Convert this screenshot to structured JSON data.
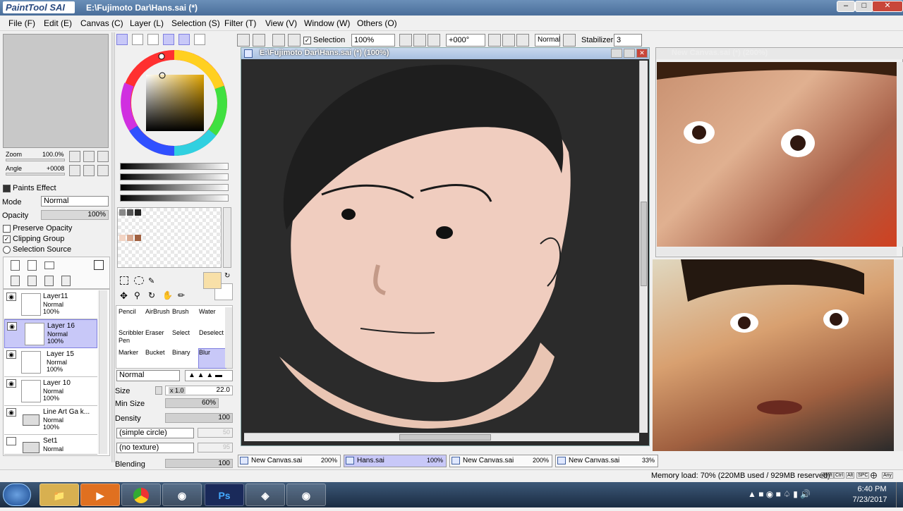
{
  "titlebar": {
    "logo": "PaintTool SAI",
    "title": "E:\\Fujimoto Dar\\Hans.sai (*)"
  },
  "menu": [
    "File (F)",
    "Edit (E)",
    "Canvas (C)",
    "Layer (L)",
    "Selection (S)",
    "Filter (T)",
    "View (V)",
    "Window (W)",
    "Others (O)"
  ],
  "toolbar": {
    "selection_label": "Selection",
    "zoom": "100%",
    "rotation": "+000°",
    "mode": "Normal",
    "stabilizer_label": "Stabilizer",
    "stabilizer_value": "3"
  },
  "navigator": {
    "zoom_label": "Zoom",
    "zoom_value": "100.0%",
    "angle_label": "Angle",
    "angle_value": "+0008"
  },
  "paints": {
    "section": "Paints Effect",
    "mode_label": "Mode",
    "mode_value": "Normal",
    "opacity_label": "Opacity",
    "opacity_value": "100%",
    "preserve_opacity": "Preserve Opacity",
    "clipping_group": "Clipping Group",
    "selection_source": "Selection Source"
  },
  "layers": [
    {
      "name": "Layer11",
      "mode": "Normal",
      "opacity": "100%"
    },
    {
      "name": "Layer 16",
      "mode": "Normal",
      "opacity": "100%"
    },
    {
      "name": "Layer 15",
      "mode": "Normal",
      "opacity": "100%"
    },
    {
      "name": "Layer 10",
      "mode": "Normal",
      "opacity": "100%"
    },
    {
      "name": "Line Art Ga k...",
      "mode": "Normal",
      "opacity": "100%"
    },
    {
      "name": "Set1",
      "mode": "Normal",
      "opacity": ""
    }
  ],
  "tools": [
    [
      "Pencil",
      "AirBrush",
      "Brush",
      "Water"
    ],
    [
      "Scribbler Pen",
      "Eraser",
      "Select",
      "Deselect"
    ],
    [
      "Marker",
      "Bucket",
      "Binary",
      "Blur"
    ]
  ],
  "brush": {
    "mode": "Normal",
    "size_label": "Size",
    "size_mult": "x 1.0",
    "size_value": "22.0",
    "minsize_label": "Min Size",
    "minsize_value": "60%",
    "density_label": "Density",
    "density_value": "100",
    "shape": "(simple circle)",
    "shape_value": "50",
    "texture": "(no texture)",
    "texture_value": "95",
    "blending_label": "Blending",
    "blending_value": "100"
  },
  "canvas_title": "E:\\Fujimoto Dar\\Hans.sai (*) (100%)",
  "photo_title": "New Canvas.sai (*) (200%)",
  "tabs": [
    {
      "name": "New Canvas.sai",
      "pct": "200%"
    },
    {
      "name": "Hans.sai",
      "pct": "100%"
    },
    {
      "name": "New Canvas.sai",
      "pct": "200%"
    },
    {
      "name": "New Canvas.sai",
      "pct": "33%"
    }
  ],
  "memory": "Memory load: 70% (220MB used / 929MB reserved)",
  "status_keys": [
    "Shift",
    "Ctrl",
    "Alt",
    "SPC",
    "Any"
  ],
  "clock": {
    "time": "6:40 PM",
    "date": "7/23/2017"
  },
  "taskbar_apps": [
    "start",
    "explorer",
    "media-player",
    "chrome",
    "network-app",
    "photoshop",
    "game-app",
    "recorder-app"
  ]
}
